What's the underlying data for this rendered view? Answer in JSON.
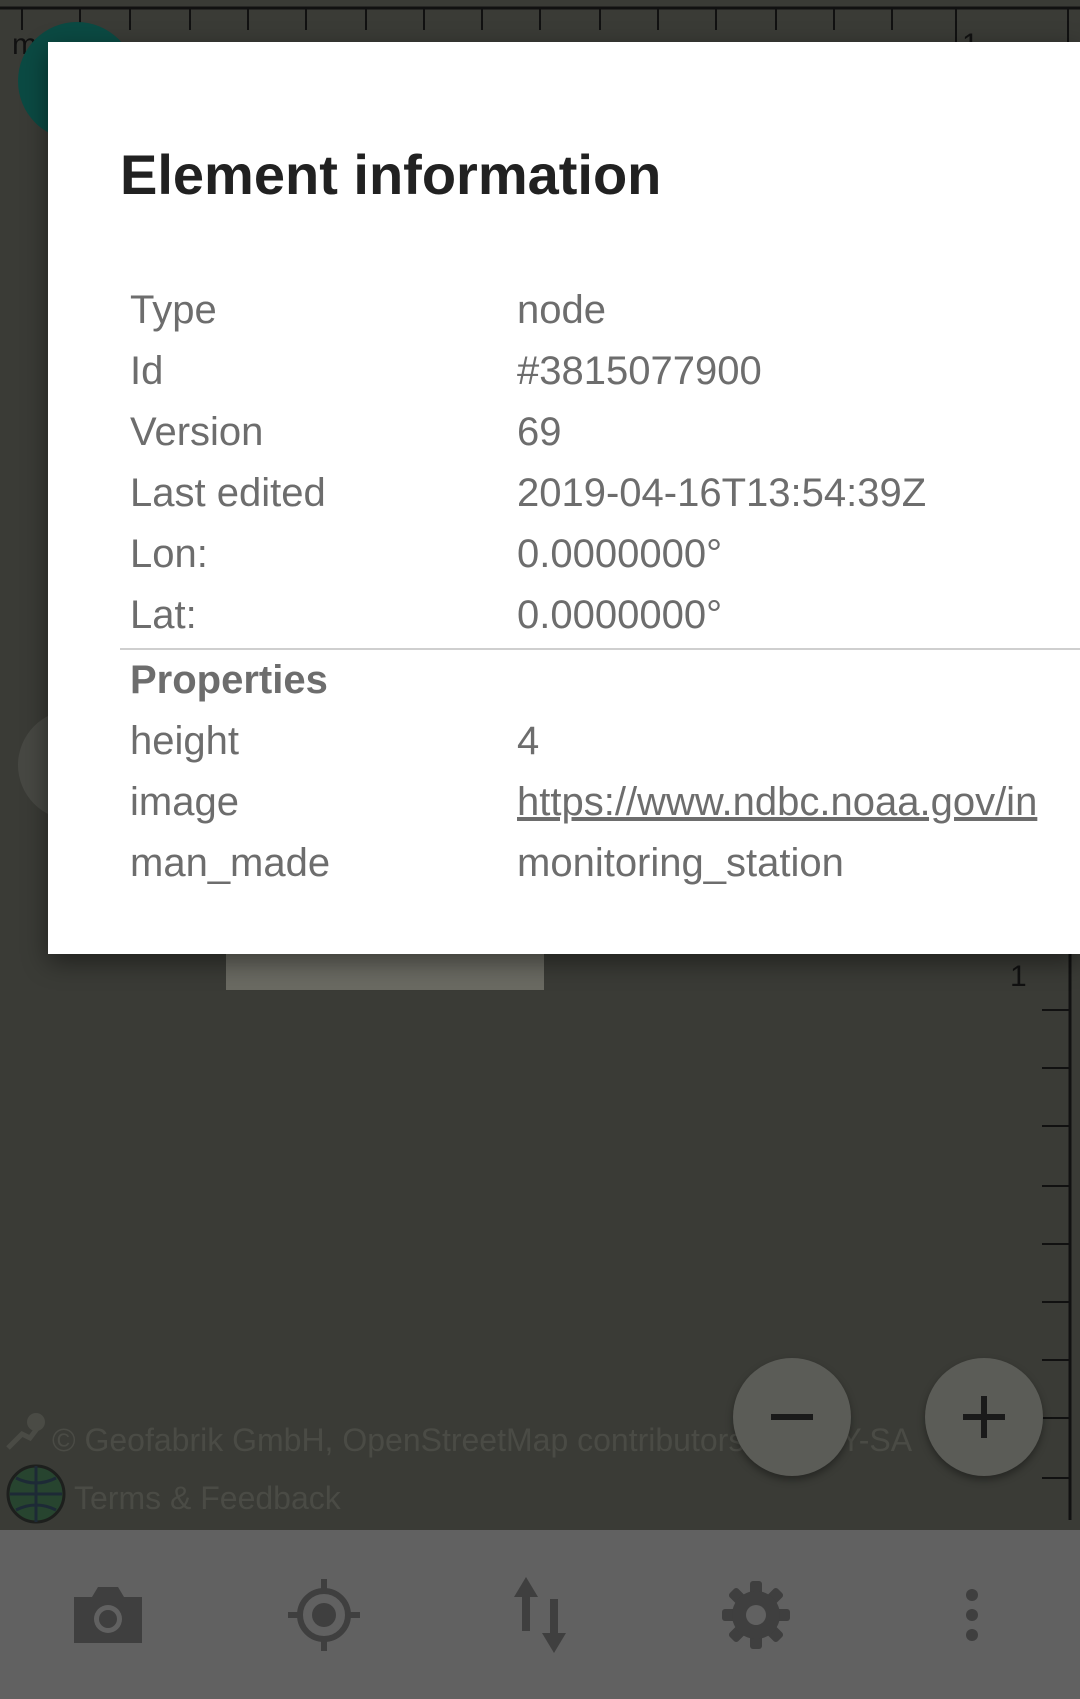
{
  "dialog": {
    "title": "Element information",
    "rows": [
      {
        "label": "Type",
        "value": "node"
      },
      {
        "label": "Id",
        "value": "#3815077900"
      },
      {
        "label": "Version",
        "value": "69"
      },
      {
        "label": "Last edited",
        "value": "2019-04-16T13:54:39Z"
      },
      {
        "label": "Lon:",
        "value": "0.0000000°"
      },
      {
        "label": "Lat:",
        "value": "0.0000000°"
      }
    ],
    "properties_header": "Properties",
    "properties": [
      {
        "label": "height",
        "value": "4"
      },
      {
        "label": "image",
        "value": "https://www.ndbc.noaa.gov/in"
      },
      {
        "label": "man_made",
        "value": "monitoring_station"
      }
    ]
  },
  "map": {
    "ruler_top_label_left": "m",
    "ruler_top_label_right": "1",
    "ruler_right_label": "1",
    "attribution": "© Geofabrik GmbH, OpenStreetMap contributors, CC-BY-SA",
    "terms_link": "Terms & Feedback",
    "zoom_out_icon": "minus-icon",
    "zoom_in_icon": "plus-icon"
  },
  "toolbar": {
    "items": [
      {
        "icon": "camera-icon"
      },
      {
        "icon": "gps-location-icon"
      },
      {
        "icon": "transfer-icon"
      },
      {
        "icon": "settings-gear-icon"
      },
      {
        "icon": "overflow-menu-icon"
      }
    ]
  },
  "colors": {
    "accent_link": "#14887a",
    "toolbar_bg": "#616161",
    "scrim_map": "#3a3b36"
  }
}
